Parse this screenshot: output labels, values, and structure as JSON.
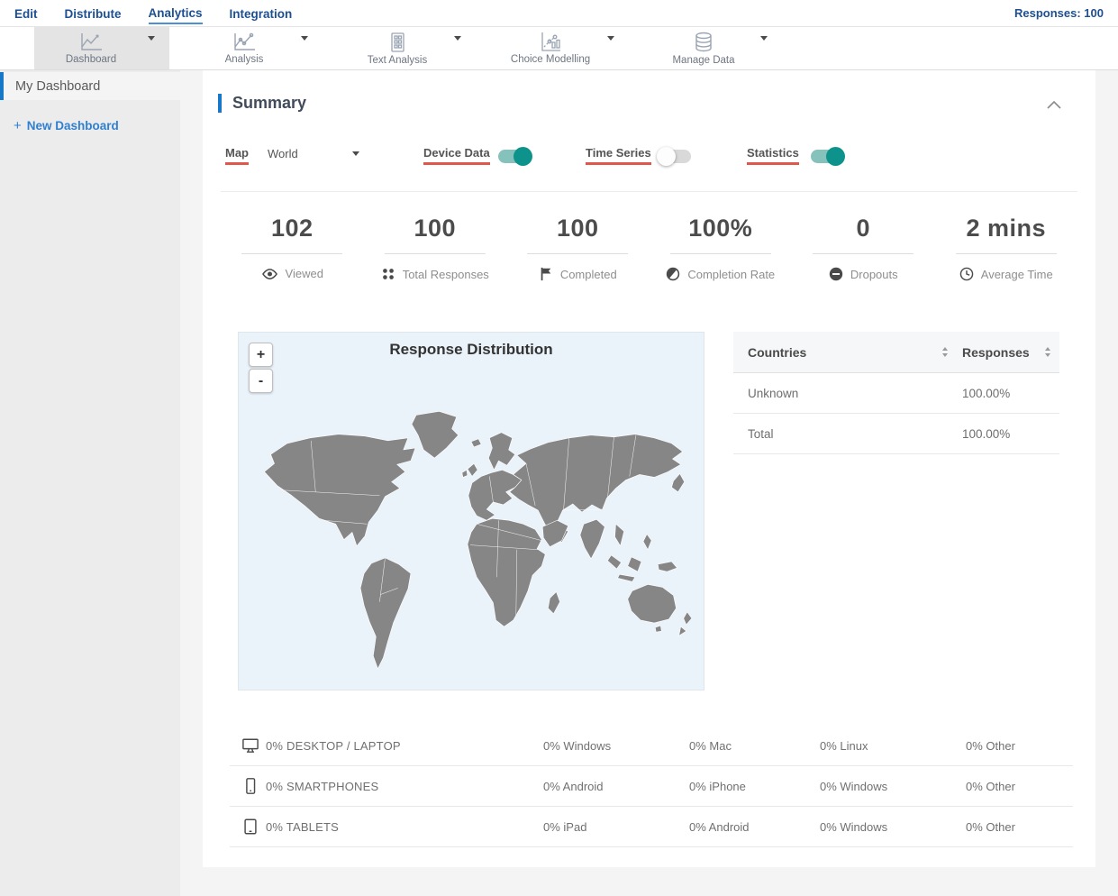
{
  "topnav": {
    "items": [
      {
        "label": "Edit",
        "active": false
      },
      {
        "label": "Distribute",
        "active": false
      },
      {
        "label": "Analytics",
        "active": true
      },
      {
        "label": "Integration",
        "active": false
      }
    ],
    "responses_label": "Responses: 100"
  },
  "toolbar": {
    "items": [
      {
        "label": "Dashboard",
        "icon": "line-chart-icon",
        "selected": true
      },
      {
        "label": "Analysis",
        "icon": "line-chart-points-icon",
        "selected": false
      },
      {
        "label": "Text Analysis",
        "icon": "document-grid-icon",
        "selected": false
      },
      {
        "label": "Choice Modelling",
        "icon": "scatter-chart-icon",
        "selected": false
      },
      {
        "label": "Manage Data",
        "icon": "database-icon",
        "selected": false
      }
    ]
  },
  "sidebar": {
    "items": [
      {
        "label": "My Dashboard",
        "selected": true
      }
    ],
    "new_dashboard": {
      "plus": "+",
      "label": "New Dashboard"
    }
  },
  "summary": {
    "title": "Summary",
    "controls": {
      "map_label": "Map",
      "map_value": "World",
      "toggles": [
        {
          "label": "Device Data",
          "on": true
        },
        {
          "label": "Time Series",
          "on": false
        },
        {
          "label": "Statistics",
          "on": true
        }
      ]
    },
    "stats": [
      {
        "value": "102",
        "label": "Viewed",
        "icon": "eye-icon"
      },
      {
        "value": "100",
        "label": "Total Responses",
        "icon": "dots-grid-icon"
      },
      {
        "value": "100",
        "label": "Completed",
        "icon": "flag-icon"
      },
      {
        "value": "100%",
        "label": "Completion Rate",
        "icon": "half-circle-icon"
      },
      {
        "value": "0",
        "label": "Dropouts",
        "icon": "minus-circle-icon"
      },
      {
        "value": "2 mins",
        "label": "Average Time",
        "icon": "clock-icon"
      }
    ],
    "map": {
      "title": "Response Distribution",
      "zoom_in": "+",
      "zoom_out": "-"
    },
    "countries_table": {
      "columns": [
        "Countries",
        "Responses"
      ],
      "rows": [
        {
          "country": "Unknown",
          "responses": "100.00%"
        },
        {
          "country": "Total",
          "responses": "100.00%"
        }
      ]
    },
    "device_table": {
      "rows": [
        {
          "icon": "desktop-icon",
          "category": "0% DESKTOP / LAPTOP",
          "cols": [
            "0% Windows",
            "0% Mac",
            "0% Linux",
            "0% Other"
          ]
        },
        {
          "icon": "smartphone-icon",
          "category": "0% SMARTPHONES",
          "cols": [
            "0% Android",
            "0% iPhone",
            "0% Windows",
            "0% Other"
          ]
        },
        {
          "icon": "tablet-icon",
          "category": "0% TABLETS",
          "cols": [
            "0% iPad",
            "0% Android",
            "0% Windows",
            "0% Other"
          ]
        }
      ]
    }
  },
  "colors": {
    "nav_blue": "#1d4f91",
    "accent_blue": "#1778c8",
    "highlight_red": "#e0584b",
    "toggle_teal": "#0d938b",
    "map_land": "#868686",
    "map_sea": "#eaf2fa"
  }
}
